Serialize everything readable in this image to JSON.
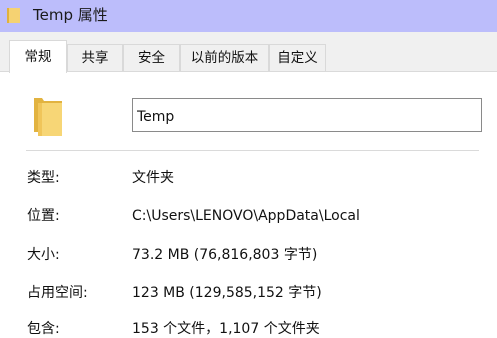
{
  "window": {
    "title": "Temp 属性",
    "title_bar_color": "#bcbdfb"
  },
  "tabs": [
    {
      "label": "常规",
      "active": true
    },
    {
      "label": "共享",
      "active": false
    },
    {
      "label": "安全",
      "active": false
    },
    {
      "label": "以前的版本",
      "active": false
    },
    {
      "label": "自定义",
      "active": false
    }
  ],
  "general": {
    "folder_name": "Temp",
    "type": {
      "label": "类型:",
      "value": "文件夹"
    },
    "location": {
      "label": "位置:",
      "value": "C:\\Users\\LENOVO\\AppData\\Local"
    },
    "size": {
      "label": "大小:",
      "value": "73.2 MB (76,816,803 字节)"
    },
    "size_on_disk": {
      "label": "占用空间:",
      "value": "123 MB (129,585,152 字节)"
    },
    "contains": {
      "label": "包含:",
      "value": "153 个文件，1,107 个文件夹"
    }
  },
  "icons": {
    "title_icon": "folder-icon",
    "main_icon": "folder-icon",
    "folder_color": "#f0c95b"
  }
}
